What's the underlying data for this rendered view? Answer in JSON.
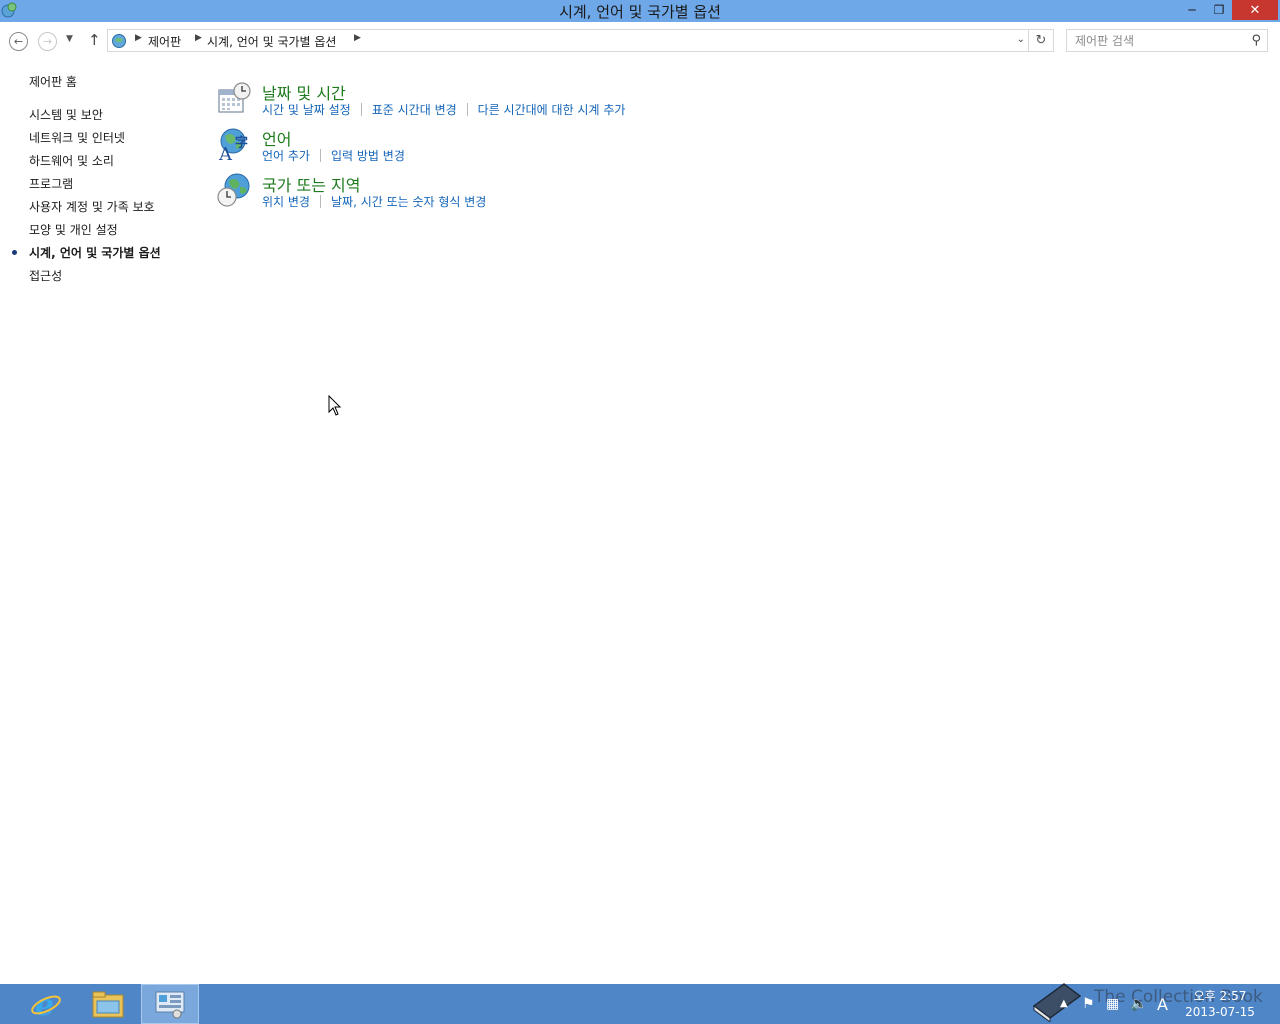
{
  "window": {
    "title": "시계, 언어 및 국가별 옵션",
    "minimize": "─",
    "maximize": "❐",
    "close": "✕"
  },
  "address": {
    "breadcrumbs": [
      "제어판",
      "시계, 언어 및 국가별 옵션"
    ],
    "search_placeholder": "제어판 검색"
  },
  "sidebar": {
    "home": "제어판 홈",
    "items": [
      "시스템 및 보안",
      "네트워크 및 인터넷",
      "하드웨어 및 소리",
      "프로그램",
      "사용자 계정 및 가족 보호",
      "모양 및 개인 설정",
      "시계, 언어 및 국가별 옵션",
      "접근성"
    ],
    "active_index": 6
  },
  "categories": [
    {
      "title": "날짜 및 시간",
      "icon": "calendar-clock-icon",
      "links": [
        "시간 및 날짜 설정",
        "표준 시간대 변경",
        "다른 시간대에 대한 시계 추가"
      ]
    },
    {
      "title": "언어",
      "icon": "language-globe-icon",
      "links": [
        "언어 추가",
        "입력 방법 변경"
      ]
    },
    {
      "title": "국가 또는 지역",
      "icon": "region-globe-clock-icon",
      "links": [
        "위치 변경",
        "날짜, 시간 또는 숫자 형식 변경"
      ]
    }
  ],
  "taskbar": {
    "apps": [
      "internet-explorer-icon",
      "file-explorer-icon",
      "control-panel-icon"
    ],
    "active_app_index": 2,
    "ime_indicator": "A",
    "clock_time": "오후 2:57",
    "clock_date": "2013-07-15",
    "watermark": "The Collection Book"
  },
  "colors": {
    "titlebar": "#6fa8e8",
    "taskbar": "#4f86c8",
    "category_title": "#1e7b1e",
    "link": "#1565b8",
    "close_button": "#c7372f"
  }
}
